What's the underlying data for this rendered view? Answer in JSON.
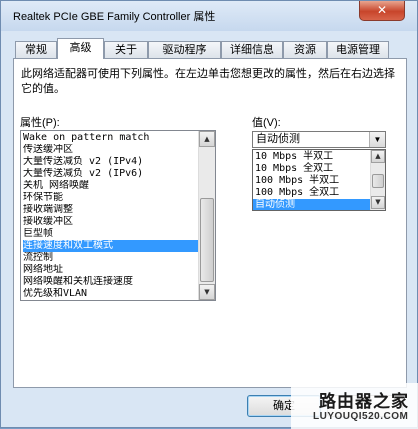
{
  "window": {
    "title": "Realtek PCIe GBE Family Controller 属性",
    "close_label": "✕"
  },
  "tabs": [
    {
      "label": "常规",
      "active": false
    },
    {
      "label": "高级",
      "active": true
    },
    {
      "label": "关于",
      "active": false
    },
    {
      "label": "驱动程序",
      "active": false
    },
    {
      "label": "详细信息",
      "active": false
    },
    {
      "label": "资源",
      "active": false
    },
    {
      "label": "电源管理",
      "active": false
    }
  ],
  "panel": {
    "description": "此网络适配器可使用下列属性。在左边单击您想更改的属性，然后在右边选择它的值。",
    "property_label": "属性(P):",
    "value_label": "值(V):"
  },
  "property_list": {
    "items": [
      "Wake on pattern match",
      "传送缓冲区",
      "大量传送减负 v2 (IPv4)",
      "大量传送减负 v2 (IPv6)",
      "关机 网络唤醒",
      "环保节能",
      "接收端调整",
      "接收缓冲区",
      "巨型帧",
      "连接速度和双工模式",
      "流控制",
      "网络地址",
      "网络唤醒和关机连接速度",
      "优先级和VLAN"
    ],
    "selected_index": 9,
    "scroll_up": "▲",
    "scroll_down": "▼"
  },
  "value_combo": {
    "selected": "自动侦测",
    "arrow": "▼",
    "options": [
      "10 Mbps 半双工",
      "10 Mbps 全双工",
      "100 Mbps 半双工",
      "100 Mbps 全双工",
      "自动侦测"
    ],
    "selected_index": 4
  },
  "buttons": {
    "ok": "确定"
  },
  "watermark": {
    "line1": "路由器之家",
    "line2": "LUYOUQI520.COM"
  }
}
